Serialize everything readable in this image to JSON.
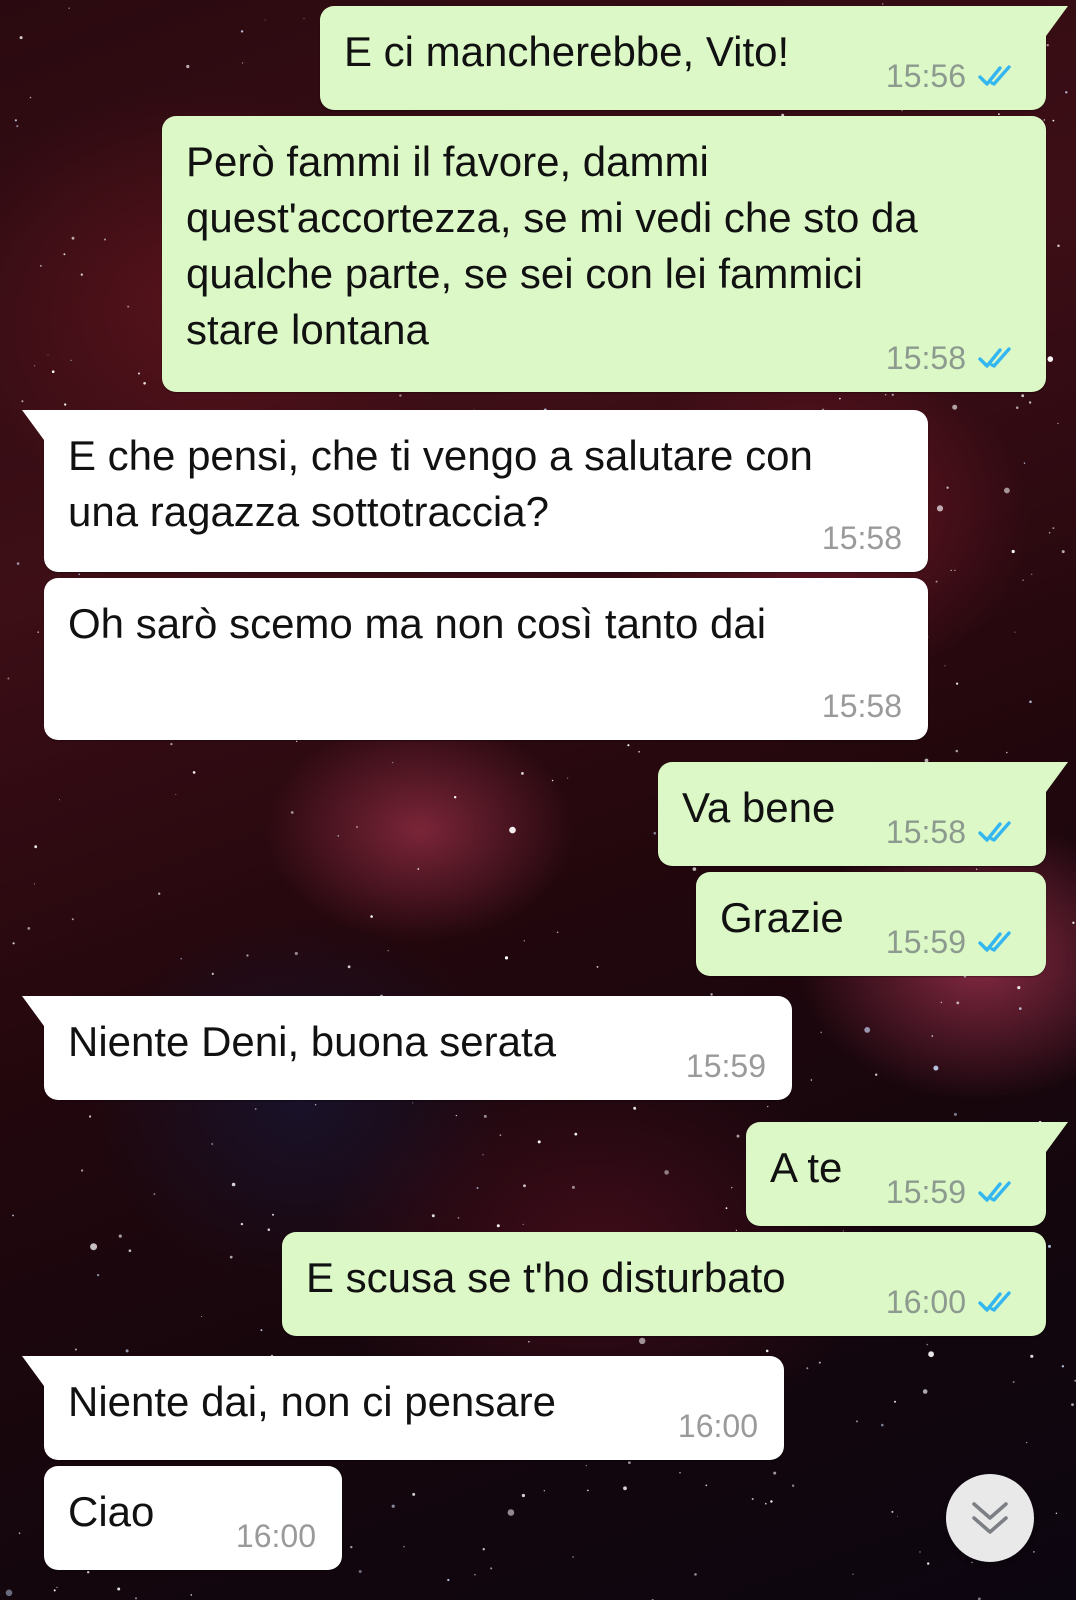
{
  "chat": {
    "messages": [
      {
        "id": "m1",
        "direction": "out",
        "text": "E ci mancherebbe, Vito!",
        "time": "15:56",
        "status": "read"
      },
      {
        "id": "m2",
        "direction": "out",
        "text": "Però fammi il favore, dammi\nquest'accortezza, se mi vedi che sto da\nqualche parte, se sei con lei fammici\nstare lontana",
        "time": "15:58",
        "status": "read"
      },
      {
        "id": "m3",
        "direction": "in",
        "text": "E che pensi, che ti vengo a salutare con\nuna ragazza sottotraccia?",
        "time": "15:58"
      },
      {
        "id": "m4",
        "direction": "in",
        "text": "Oh sarò scemo ma non così tanto dai",
        "time": "15:58"
      },
      {
        "id": "m5",
        "direction": "out",
        "text": "Va bene",
        "time": "15:58",
        "status": "read"
      },
      {
        "id": "m6",
        "direction": "out",
        "text": "Grazie",
        "time": "15:59",
        "status": "read"
      },
      {
        "id": "m7",
        "direction": "in",
        "text": "Niente Deni, buona serata",
        "time": "15:59"
      },
      {
        "id": "m8",
        "direction": "out",
        "text": "A te",
        "time": "15:59",
        "status": "read"
      },
      {
        "id": "m9",
        "direction": "out",
        "text": "E scusa se t'ho disturbato",
        "time": "16:00",
        "status": "read"
      },
      {
        "id": "m10",
        "direction": "in",
        "text": "Niente dai, non ci pensare",
        "time": "16:00"
      },
      {
        "id": "m11",
        "direction": "in",
        "text": "Ciao",
        "time": "16:00"
      }
    ]
  },
  "icons": {
    "read_receipt": "double-check-icon",
    "scroll_button": "chevron-double-down-icon"
  },
  "colors": {
    "outgoing_bubble": "#dcf8c6",
    "incoming_bubble": "#ffffff",
    "read_ticks": "#34b7f1",
    "timestamp": "#8c9a8f"
  }
}
